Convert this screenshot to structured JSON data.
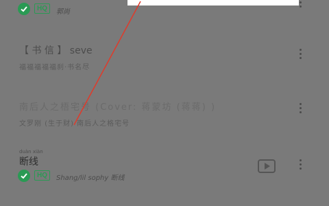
{
  "songs": [
    {
      "title": "",
      "badge": "HQ",
      "artist": "郭尚"
    },
    {
      "title": "【 书 信 】 seve",
      "subtitle": "福福福福福刹·书名尽",
      "badge": ""
    },
    {
      "title": "南后人之梧宅号 (Cover: 蒋蒙坊 (蒋蒋) )",
      "subtitle": "文罗刚 (生于财) 南后人之格宅号"
    },
    {
      "title": "断线",
      "pinyin": "duàn  xiàn",
      "badge": "HQ",
      "artist": "Shang/lil sophy 断线"
    }
  ],
  "colors": {
    "accent": "#2a9a54",
    "overlay": "#7a7a7a",
    "annotation": "#e03a2a"
  },
  "icons": {
    "check": "check-icon",
    "more": "more-vertical-icon",
    "play": "video-play-icon"
  }
}
